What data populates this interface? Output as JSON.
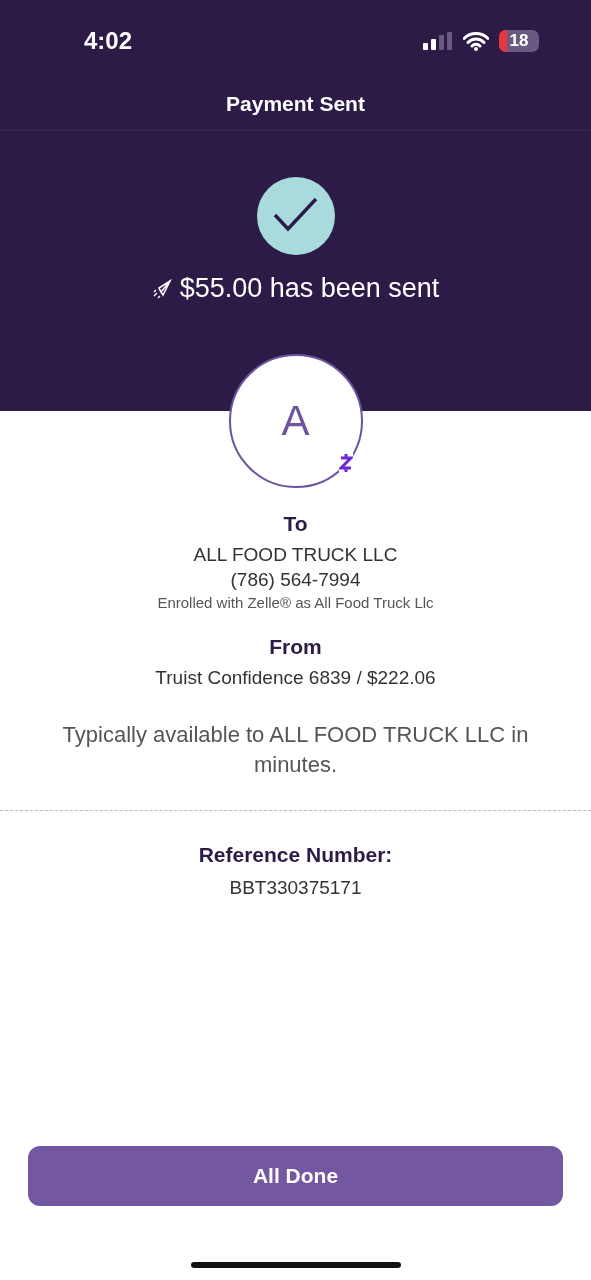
{
  "status_bar": {
    "time": "4:02",
    "battery": "18"
  },
  "header": {
    "title": "Payment Sent",
    "amount_text": "$55.00 has been sent"
  },
  "recipient": {
    "initial": "A",
    "label": "To",
    "name": "ALL FOOD TRUCK LLC",
    "phone": "(786) 564-7994",
    "enrolled": "Enrolled with Zelle® as All Food Truck Llc"
  },
  "sender": {
    "label": "From",
    "account": "Truist Confidence 6839 / $222.06"
  },
  "availability": "Typically available to ALL FOOD TRUCK LLC in minutes.",
  "reference": {
    "label": "Reference Number:",
    "number": "BBT330375171"
  },
  "button": "All Done"
}
